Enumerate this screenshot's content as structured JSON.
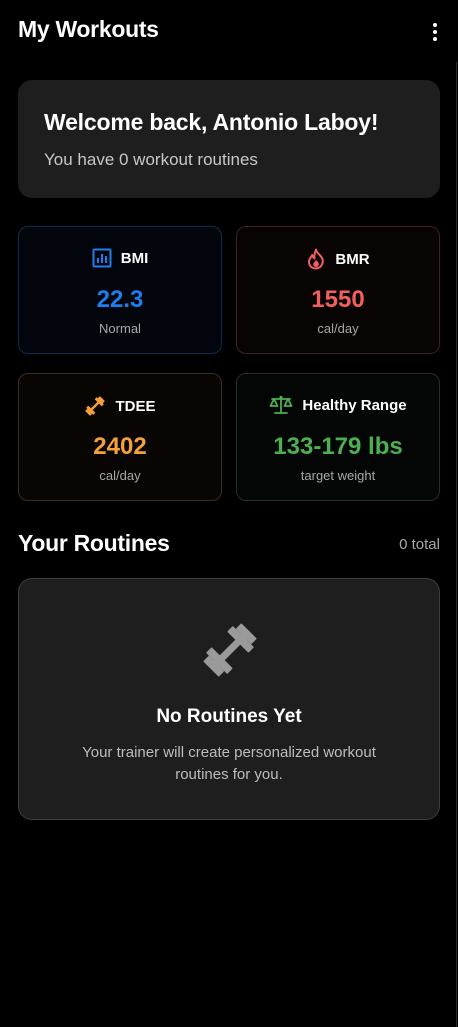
{
  "header": {
    "title": "My Workouts",
    "menu_icon": "more-vertical-icon"
  },
  "welcome": {
    "title": "Welcome back, Antonio Laboy!",
    "subtitle": "You have 0 workout routines"
  },
  "stats": {
    "bmi": {
      "label": "BMI",
      "value": "22.3",
      "unit": "Normal",
      "icon": "bar-chart-icon",
      "color": "#1e7ef0"
    },
    "bmr": {
      "label": "BMR",
      "value": "1550",
      "unit": "cal/day",
      "icon": "flame-icon",
      "color": "#f0605e"
    },
    "tdee": {
      "label": "TDEE",
      "value": "2402",
      "unit": "cal/day",
      "icon": "dumbbell-icon",
      "color": "#f5a03a"
    },
    "healthy_range": {
      "label": "Healthy Range",
      "value": "133-179 lbs",
      "unit": "target weight",
      "icon": "scale-icon",
      "color": "#4caf50"
    }
  },
  "routines": {
    "title": "Your Routines",
    "count_text": "0 total",
    "empty_icon": "dumbbell-icon",
    "empty_title": "No Routines Yet",
    "empty_text": "Your trainer will create personalized workout routines for you."
  }
}
